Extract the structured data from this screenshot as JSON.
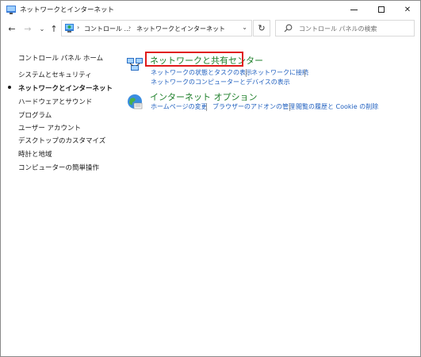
{
  "window": {
    "title": "ネットワークとインターネット",
    "minimize_icon": "minimize-icon",
    "maximize_icon": "maximize-icon",
    "close_icon": "close-icon"
  },
  "address": {
    "breadcrumbs": [
      "コントロール ...",
      "ネットワークとインターネット"
    ],
    "search_placeholder": "コントロール パネルの検索"
  },
  "sidebar": {
    "items": [
      {
        "label": "コントロール パネル ホーム",
        "current": false
      },
      {
        "label": "システムとセキュリティ",
        "current": false
      },
      {
        "label": "ネットワークとインターネット",
        "current": true
      },
      {
        "label": "ハードウェアとサウンド",
        "current": false
      },
      {
        "label": "プログラム",
        "current": false
      },
      {
        "label": "ユーザー アカウント",
        "current": false
      },
      {
        "label": "デスクトップのカスタマイズ",
        "current": false
      },
      {
        "label": "時計と地域",
        "current": false
      },
      {
        "label": "コンピューターの簡単操作",
        "current": false
      }
    ]
  },
  "categories": [
    {
      "title": "ネットワークと共有センター",
      "icon": "network-sharing-icon",
      "links": [
        "ネットワークの状態とタスクの表示",
        "ネットワークに接続",
        "ネットワークのコンピューターとデバイスの表示"
      ]
    },
    {
      "title": "インターネット オプション",
      "icon": "internet-globe-icon",
      "links": [
        "ホームページの変更",
        "ブラウザーのアドオンの管理",
        "閲覧の履歴と Cookie の削除"
      ]
    }
  ],
  "colors": {
    "category_title": "#1e7f2a",
    "link": "#1f5fbf",
    "highlight_border": "#e01a1a"
  }
}
